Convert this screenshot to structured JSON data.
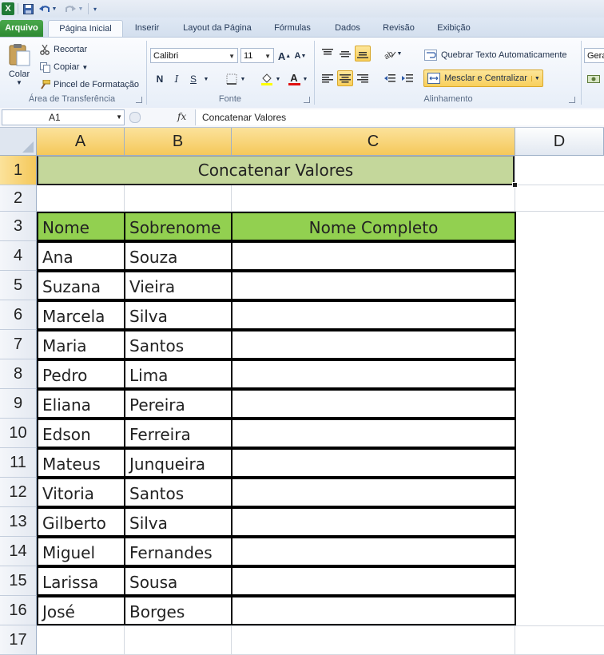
{
  "quick_access": {
    "excel_logo": "X",
    "save_icon": "save-icon",
    "undo_icon": "undo-icon",
    "redo_icon": "redo-icon"
  },
  "tabs": [
    {
      "label": "Arquivo"
    },
    {
      "label": "Página Inicial"
    },
    {
      "label": "Inserir"
    },
    {
      "label": "Layout da Página"
    },
    {
      "label": "Fórmulas"
    },
    {
      "label": "Dados"
    },
    {
      "label": "Revisão"
    },
    {
      "label": "Exibição"
    }
  ],
  "clipboard": {
    "paste_label": "Colar",
    "cut_label": "Recortar",
    "copy_label": "Copiar",
    "format_painter_label": "Pincel de Formatação",
    "group_label": "Área de Transferência"
  },
  "font": {
    "name": "Calibri",
    "size": "11",
    "bold": "N",
    "italic": "I",
    "underline": "S",
    "grow": "A",
    "shrink": "A",
    "color_letter": "A",
    "group_label": "Fonte"
  },
  "alignment": {
    "wrap_label": "Quebrar Texto Automaticamente",
    "merge_label": "Mesclar e Centralizar",
    "group_label": "Alinhamento"
  },
  "number": {
    "format_partial": "Gera"
  },
  "formula_bar": {
    "name_box": "A1",
    "fx": "fx",
    "content": "Concatenar Valores"
  },
  "columns": [
    "A",
    "B",
    "C",
    "D"
  ],
  "rows": [
    "1",
    "2",
    "3",
    "4",
    "5",
    "6",
    "7",
    "8",
    "9",
    "10",
    "11",
    "12",
    "13",
    "14",
    "15",
    "16",
    "17"
  ],
  "sheet": {
    "title": "Concatenar Valores",
    "headers": {
      "nome": "Nome",
      "sobrenome": "Sobrenome",
      "completo": "Nome Completo"
    },
    "records": [
      {
        "nome": "Ana",
        "sobrenome": "Souza"
      },
      {
        "nome": "Suzana",
        "sobrenome": "Vieira"
      },
      {
        "nome": "Marcela",
        "sobrenome": "Silva"
      },
      {
        "nome": "Maria",
        "sobrenome": "Santos"
      },
      {
        "nome": "Pedro",
        "sobrenome": "Lima"
      },
      {
        "nome": "Eliana",
        "sobrenome": "Pereira"
      },
      {
        "nome": "Edson",
        "sobrenome": "Ferreira"
      },
      {
        "nome": "Mateus",
        "sobrenome": "Junqueira"
      },
      {
        "nome": "Vitoria",
        "sobrenome": "Santos"
      },
      {
        "nome": "Gilberto",
        "sobrenome": "Silva"
      },
      {
        "nome": "Miguel",
        "sobrenome": "Fernandes"
      },
      {
        "nome": "Larissa",
        "sobrenome": "Sousa"
      },
      {
        "nome": "José",
        "sobrenome": "Borges"
      }
    ]
  },
  "colors": {
    "title_fill": "#c4d79b",
    "header_fill": "#92d050",
    "selection": "#f5c85a"
  }
}
